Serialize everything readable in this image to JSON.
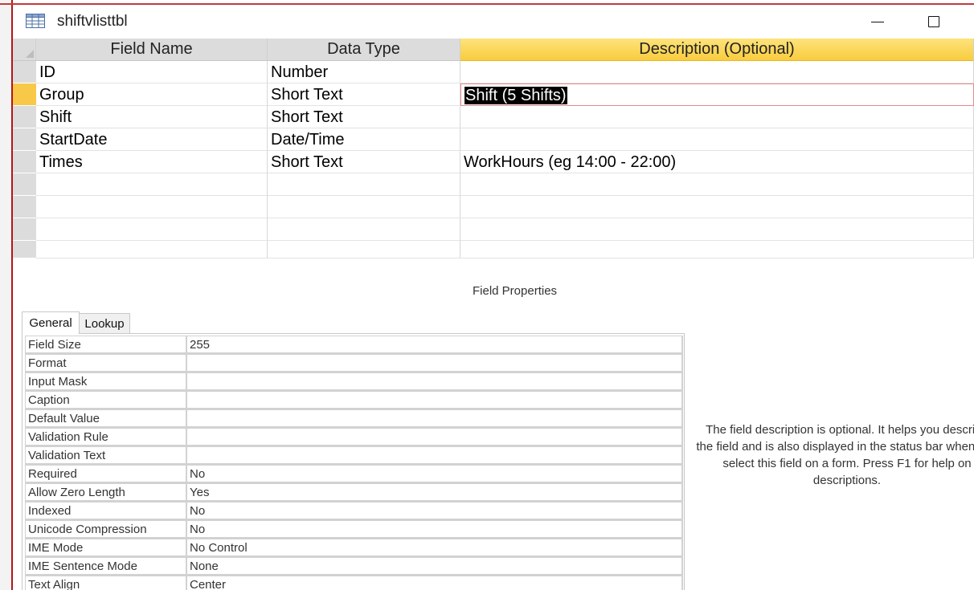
{
  "window": {
    "title": "shiftvlisttbl",
    "icon": "table-icon",
    "accent_color": "#b3161b"
  },
  "grid": {
    "headers": {
      "field_name": "Field Name",
      "data_type": "Data Type",
      "description": "Description (Optional)"
    },
    "rows": [
      {
        "field": "ID",
        "type": "Number",
        "desc": ""
      },
      {
        "field": "Group",
        "type": "Short Text",
        "desc": "Shift (5 Shifts)"
      },
      {
        "field": "Shift",
        "type": "Short Text",
        "desc": ""
      },
      {
        "field": "StartDate",
        "type": "Date/Time",
        "desc": ""
      },
      {
        "field": "Times",
        "type": "Short Text",
        "desc": "WorkHours (eg 14:00 - 22:00)"
      },
      {
        "field": "",
        "type": "",
        "desc": ""
      },
      {
        "field": "",
        "type": "",
        "desc": ""
      },
      {
        "field": "",
        "type": "",
        "desc": ""
      },
      {
        "field": "",
        "type": "",
        "desc": ""
      }
    ],
    "active_row": 1,
    "header_highlight_color": "#f9cc3e"
  },
  "field_properties": {
    "label": "Field Properties",
    "tabs": [
      "General",
      "Lookup"
    ],
    "active_tab": "General",
    "properties": [
      {
        "name": "Field Size",
        "value": "255"
      },
      {
        "name": "Format",
        "value": ""
      },
      {
        "name": "Input Mask",
        "value": ""
      },
      {
        "name": "Caption",
        "value": ""
      },
      {
        "name": "Default Value",
        "value": ""
      },
      {
        "name": "Validation Rule",
        "value": ""
      },
      {
        "name": "Validation Text",
        "value": ""
      },
      {
        "name": "Required",
        "value": "No"
      },
      {
        "name": "Allow Zero Length",
        "value": "Yes"
      },
      {
        "name": "Indexed",
        "value": "No"
      },
      {
        "name": "Unicode Compression",
        "value": "No"
      },
      {
        "name": "IME Mode",
        "value": "No Control"
      },
      {
        "name": "IME Sentence Mode",
        "value": "None"
      },
      {
        "name": "Text Align",
        "value": "Center"
      }
    ],
    "help_text": "The field description is optional. It helps you describe the field and is also displayed in the status bar when you select this field on a form. Press F1 for help on descriptions."
  }
}
